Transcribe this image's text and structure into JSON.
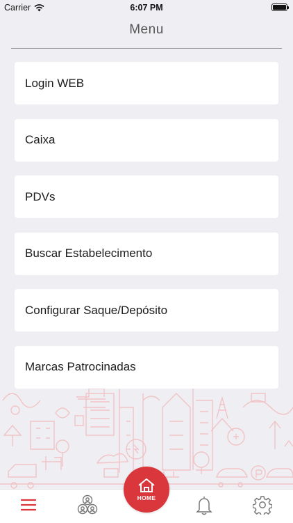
{
  "status_bar": {
    "carrier": "Carrier",
    "time": "6:07 PM"
  },
  "header": {
    "title": "Menu"
  },
  "menu": {
    "items": [
      {
        "label": "Login WEB"
      },
      {
        "label": "Caixa"
      },
      {
        "label": "PDVs"
      },
      {
        "label": "Buscar Estabelecimento"
      },
      {
        "label": "Configurar Saque/Depósito"
      },
      {
        "label": "Marcas Patrocinadas"
      }
    ]
  },
  "tab_bar": {
    "home_label": "HOME",
    "tabs": [
      {
        "icon": "menu-icon"
      },
      {
        "icon": "people-icon"
      },
      {
        "icon": "home-icon"
      },
      {
        "icon": "bell-icon"
      },
      {
        "icon": "gear-icon"
      }
    ]
  },
  "colors": {
    "accent": "#d9373b",
    "background": "#efeef3",
    "card": "#ffffff",
    "illustration": "#f0c4c6"
  }
}
